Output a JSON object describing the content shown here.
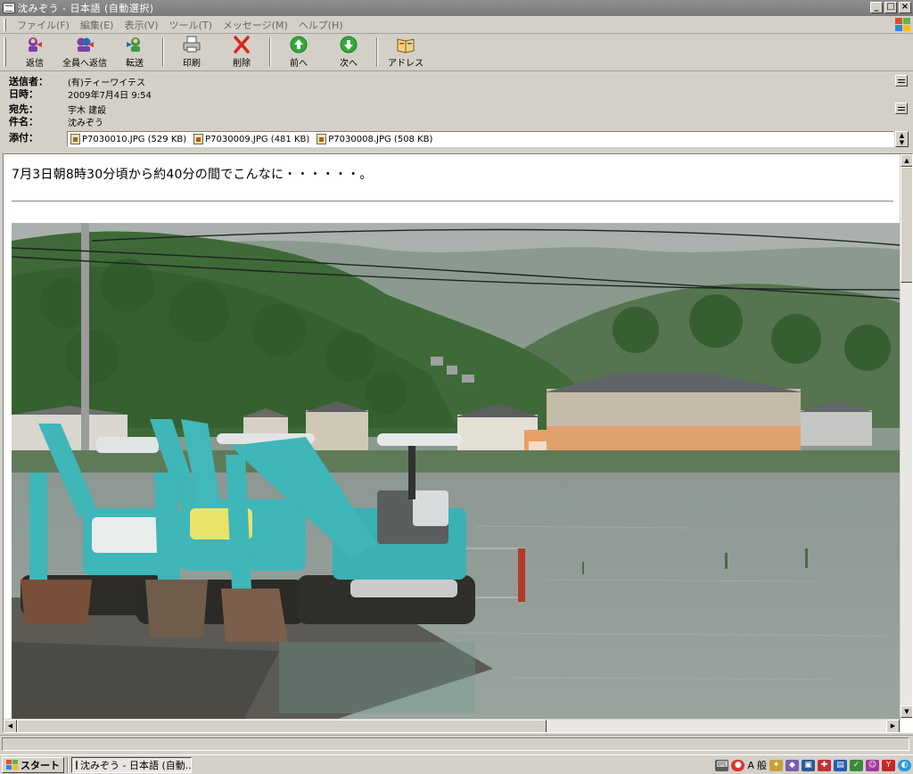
{
  "window": {
    "title": "沈みぞう - 日本語 (自動選択)",
    "controls": {
      "minimize": "_",
      "maximize": "□",
      "close": "×"
    }
  },
  "menu": [
    "ファイル(F)",
    "編集(E)",
    "表示(V)",
    "ツール(T)",
    "メッセージ(M)",
    "ヘルプ(H)"
  ],
  "toolbar": {
    "reply": "返信",
    "reply_all": "全員へ返信",
    "forward": "転送",
    "print": "印刷",
    "delete": "削除",
    "previous": "前へ",
    "next": "次へ",
    "addresses": "アドレス"
  },
  "header": {
    "from_label": "送信者：",
    "from_value": "(有)ティーワイテス",
    "date_label": "日時：",
    "date_value": "2009年7月4日 9:54",
    "to_label": "宛先：",
    "to_value": "宇木 建設",
    "subject_label": "件名：",
    "subject_value": "沈みぞう",
    "attach_label": "添付：",
    "attachments": [
      {
        "name": "P7030010.JPG (529 KB)"
      },
      {
        "name": "P7030009.JPG (481 KB)"
      },
      {
        "name": "P7030008.JPG (508 KB)"
      }
    ]
  },
  "message": {
    "body_text": "7月3日朝8時30分頃から約40分の間でこんなに・・・・・・。"
  },
  "taskbar": {
    "start_label": "スタート",
    "task_label": "沈みぞう - 日本語 (自動...",
    "ime_a": "A",
    "ime_mode": "般"
  },
  "colors": {
    "face": "#d4d0c8",
    "titlebar": "#808080",
    "excavator": "#3fb6b8",
    "floodwater": "#8e9a95"
  }
}
